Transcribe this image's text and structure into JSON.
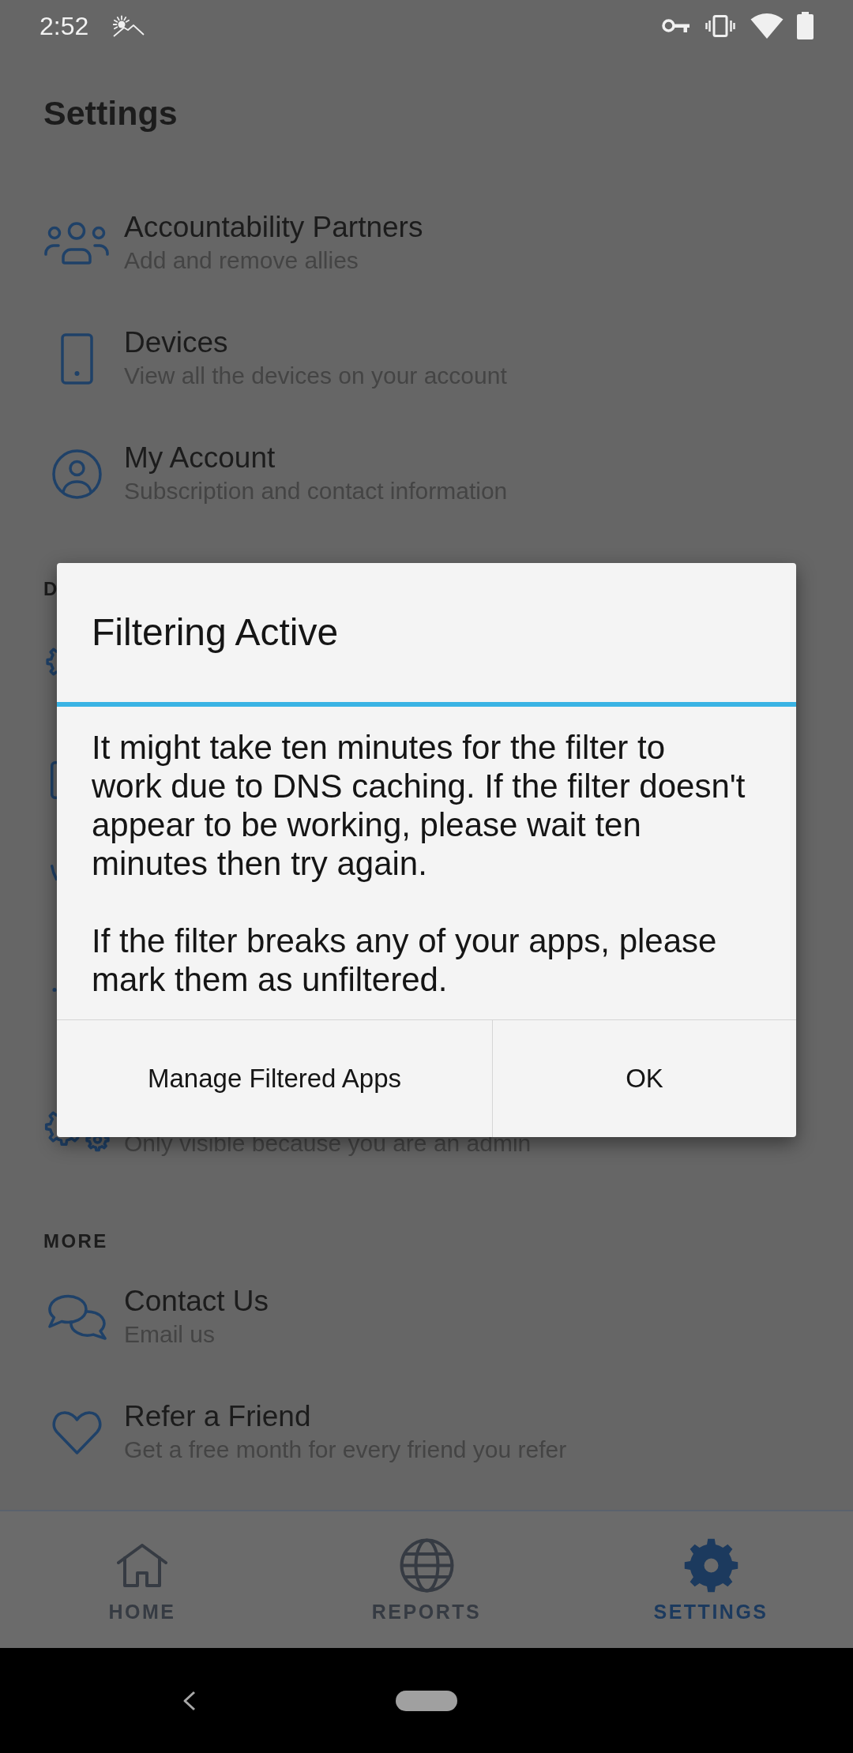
{
  "status_bar": {
    "time": "2:52"
  },
  "title": "Settings",
  "sections": [
    {
      "items": [
        {
          "title": "Accountability Partners",
          "subtitle": "Add and remove allies"
        },
        {
          "title": "Devices",
          "subtitle": "View all the devices on your account"
        },
        {
          "title": "My Account",
          "subtitle": "Subscription and contact information"
        }
      ]
    },
    {
      "header": "D",
      "items": [
        {
          "subtitle": "Only visible because you are an admin"
        }
      ]
    },
    {
      "header": "MORE",
      "items": [
        {
          "title": "Contact Us",
          "subtitle": "Email us"
        },
        {
          "title": "Refer a Friend",
          "subtitle": "Get a free month for every friend you refer"
        }
      ]
    }
  ],
  "dialog": {
    "title": "Filtering Active",
    "message": [
      "It might take ten minutes for the filter to\nwork due to DNS caching. If the filter doesn't\nappear to be working, please wait ten\nminutes then try again.",
      "If the filter breaks any of your apps, please\nmark them as unfiltered."
    ],
    "buttons": [
      "Manage Filtered Apps",
      "OK"
    ]
  },
  "bottom_nav": [
    {
      "label": "HOME",
      "selected": false
    },
    {
      "label": "REPORTS",
      "selected": false
    },
    {
      "label": "SETTINGS",
      "selected": true
    }
  ]
}
